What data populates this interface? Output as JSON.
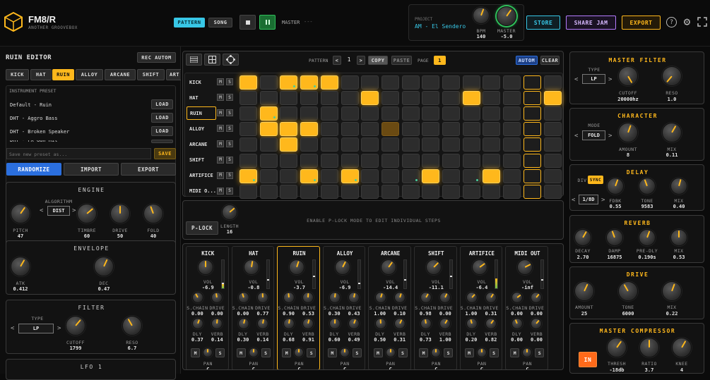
{
  "app": {
    "title": "FM8/R",
    "subtitle": "ANOTHER GROOVEBOX"
  },
  "header": {
    "tabs": [
      {
        "label": "PATTERN",
        "active": true
      },
      {
        "label": "SONG",
        "active": false
      }
    ],
    "stop_icon": "stop-icon",
    "pause_icon": "pause-icon",
    "master_label": "MASTER",
    "master_value": "---",
    "project_label": "PROJECT",
    "project_name": "AM - El Sendero",
    "bpm_label": "BPM",
    "bpm_value": "140",
    "master_vol_label": "MASTER",
    "master_vol_value": "-5.0",
    "store": "STORE",
    "share": "SHARE JAM",
    "export": "EXPORT"
  },
  "editor": {
    "title": "RUIN EDITOR",
    "rec_autom": "REC AUTOM",
    "tabs": [
      "KICK",
      "HAT",
      "RUIN",
      "ALLOY",
      "ARCANE",
      "SHIFT",
      "ART"
    ],
    "active_tab": "RUIN",
    "preset_header": "INSTRUMENT PRESET",
    "presets": [
      "Default - Ruin",
      "DHT - Aggro Bass",
      "DHT - Broken Speaker",
      "DHT - FX Gun Hit"
    ],
    "load": "LOAD",
    "save_placeholder": "Save new preset as...",
    "save": "SAVE",
    "randomize": "RANDOMIZE",
    "import": "IMPORT",
    "export": "EXPORT"
  },
  "engine": {
    "title": "ENGINE",
    "algorithm_label": "ALGORITHM",
    "algorithm": "DIST",
    "knobs": [
      {
        "label": "PITCH",
        "value": "47"
      },
      {
        "label": "TIMBRE",
        "value": "60"
      },
      {
        "label": "DRIVE",
        "value": "50"
      },
      {
        "label": "FOLD",
        "value": "40"
      }
    ]
  },
  "envelope": {
    "title": "ENVELOPE",
    "knobs": [
      {
        "label": "ATK",
        "value": "0.412"
      },
      {
        "label": "DEC",
        "value": "0.47"
      }
    ]
  },
  "filter": {
    "title": "FILTER",
    "type_label": "TYPE",
    "type": "LP",
    "knobs": [
      {
        "label": "CUTOFF",
        "value": "1799"
      },
      {
        "label": "RESO",
        "value": "6.7"
      }
    ]
  },
  "lfo": {
    "title": "LFO 1"
  },
  "sequencer": {
    "pattern_label": "PATTERN",
    "pattern_value": "1",
    "copy": "COPY",
    "paste": "PASTE",
    "page_label": "PAGE",
    "page_value": "1",
    "autom": "AUTOM",
    "clear": "CLEAR",
    "tracks": [
      {
        "name": "KICK",
        "steps": "1011100000000000",
        "plock": [
          2,
          3
        ]
      },
      {
        "name": "HAT",
        "steps": "0000001000010001",
        "plock": []
      },
      {
        "name": "RUIN",
        "steps": "0100000000000000",
        "plock": [
          1
        ]
      },
      {
        "name": "ALLOY",
        "steps": "0111000200000000",
        "plock": []
      },
      {
        "name": "ARCANE",
        "steps": "0010000000000000",
        "plock": []
      },
      {
        "name": "SHIFT",
        "steps": "0000000000000000",
        "plock": []
      },
      {
        "name": "ARTIFICE",
        "steps": "1001010001001000",
        "plock": [
          0,
          3,
          5,
          8,
          11
        ]
      },
      {
        "name": "MIDI O...",
        "steps": "0000000000000000",
        "plock": []
      }
    ],
    "m": "M",
    "s": "S",
    "plock_button": "P-LOCK",
    "length_label": "LENGTH",
    "length_value": "16",
    "plock_hint": "ENABLE P-LOCK MODE TO EDIT INDIVIDUAL STEPS"
  },
  "mixer": {
    "vol_label": "VOL",
    "schain_label": "S.CHAIN",
    "drive_label": "DRIVE",
    "dly_label": "DLY",
    "verb_label": "VERB",
    "pan_label": "PAN",
    "channels": [
      {
        "name": "KICK",
        "vol": "-6.9",
        "schain": "0.00",
        "drive": "0.00",
        "dly": "0.37",
        "verb": "0.14",
        "pan": "C"
      },
      {
        "name": "HAT",
        "vol": "-0.8",
        "schain": "0.00",
        "drive": "0.77",
        "dly": "0.30",
        "verb": "0.14",
        "pan": "C"
      },
      {
        "name": "RUIN",
        "vol": "-3.7",
        "schain": "0.90",
        "drive": "0.53",
        "dly": "0.68",
        "verb": "0.91",
        "pan": "C"
      },
      {
        "name": "ALLOY",
        "vol": "-6.9",
        "schain": "0.30",
        "drive": "0.43",
        "dly": "0.60",
        "verb": "0.49",
        "pan": "C"
      },
      {
        "name": "ARCANE",
        "vol": "-14.4",
        "schain": "1.00",
        "drive": "0.10",
        "dly": "0.50",
        "verb": "0.31",
        "pan": "C"
      },
      {
        "name": "SHIFT",
        "vol": "-11.1",
        "schain": "0.98",
        "drive": "0.00",
        "dly": "0.73",
        "verb": "1.00",
        "pan": "C"
      },
      {
        "name": "ARTIFICE",
        "vol": "-6.4",
        "schain": "1.00",
        "drive": "0.31",
        "dly": "0.20",
        "verb": "0.82",
        "pan": "C"
      },
      {
        "name": "MIDI OUT",
        "vol": "-inf",
        "schain": "0.00",
        "drive": "0.00",
        "dly": "0.00",
        "verb": "0.00",
        "pan": "C"
      }
    ]
  },
  "fx": {
    "master_filter": {
      "title": "MASTER FILTER",
      "type_label": "TYPE",
      "type": "LP",
      "cutoff_label": "CUTOFF",
      "cutoff": "20000hz",
      "reso_label": "RESO",
      "reso": "1.0"
    },
    "character": {
      "title": "CHARACTER",
      "mode_label": "MODE",
      "mode": "FOLD",
      "amount_label": "AMOUNT",
      "amount": "8",
      "mix_label": "MIX",
      "mix": "0.11"
    },
    "delay": {
      "title": "DELAY",
      "div_label": "DIV",
      "sync": "SYNC",
      "div": "1/8D",
      "fdbk_label": "FDBK",
      "fdbk": "0.55",
      "tone_label": "TONE",
      "tone": "9583",
      "mix_label": "MIX",
      "mix": "0.40"
    },
    "reverb": {
      "title": "REVERB",
      "decay_label": "DECAY",
      "decay": "2.70",
      "damp_label": "DAMP",
      "damp": "16875",
      "predly_label": "PRE-DLY",
      "predly": "0.190s",
      "mix_label": "MIX",
      "mix": "0.53"
    },
    "drive": {
      "title": "DRIVE",
      "amount_label": "AMOUNT",
      "amount": "25",
      "tone_label": "TONE",
      "tone": "6000",
      "mix_label": "MIX",
      "mix": "0.22"
    },
    "compressor": {
      "title": "MASTER COMPRESSOR",
      "in": "IN",
      "thresh_label": "THRESH",
      "thresh": "-18db",
      "ratio_label": "RATIO",
      "ratio": "3.7",
      "knee_label": "KNEE",
      "knee": "4"
    }
  },
  "colors": {
    "accent": "#ffb81c",
    "bg": "#0b0b0b",
    "panel": "#121212",
    "teal": "#38c7e6",
    "purple": "#b57cff"
  }
}
